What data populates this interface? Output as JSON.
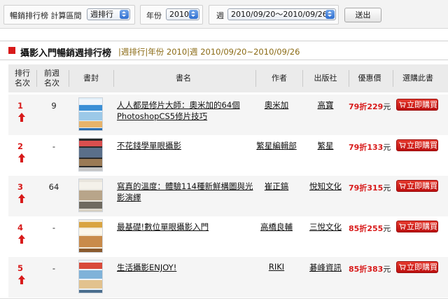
{
  "filters": {
    "ranking_label": "暢銷排行榜 計算區間",
    "ranking_value": "週排行",
    "year_label": "年份",
    "year_value": "2010",
    "week_label": "週",
    "week_value": "2010/09/20～2010/09/26",
    "submit_label": "送出"
  },
  "heading": {
    "title": "攝影入門暢銷週排行榜",
    "subtitle": "|週排行|年份 2010|週 2010/09/20~2010/09/26"
  },
  "columns": {
    "rank": "排行名次",
    "prev": "前週名次",
    "cover": "書封",
    "title": "書名",
    "author": "作者",
    "publisher": "出版社",
    "price": "優惠價",
    "buy": "選購此書"
  },
  "buy_label": "立即購買",
  "colors": {
    "accent_red": "#d81a1a",
    "header_gray": "#ebebeb",
    "subtitle_gold": "#8a6a14"
  },
  "rows": [
    {
      "rank": "1",
      "prev": "9",
      "title": "人人都是修片大師：奧米加的64個PhotoshopCS5修片技巧",
      "author": "奧米加",
      "publisher": "高寶",
      "discount": "79折",
      "price": "229",
      "currency": "元"
    },
    {
      "rank": "2",
      "prev": "-",
      "title": "不花錢學單眼攝影",
      "author": "繁星編輯部",
      "publisher": "繁星",
      "discount": "79折",
      "price": "133",
      "currency": "元"
    },
    {
      "rank": "3",
      "prev": "64",
      "title": "寫真的溫度：體驗114種新鮮構圖與光影演繹",
      "author": "崔正鎬",
      "publisher": "悅知文化",
      "discount": "79折",
      "price": "315",
      "currency": "元"
    },
    {
      "rank": "4",
      "prev": "-",
      "title": "最基礎!數位單眼攝影入門",
      "author": "高橋良輔",
      "publisher": "三悅文化",
      "discount": "85折",
      "price": "255",
      "currency": "元"
    },
    {
      "rank": "5",
      "prev": "-",
      "title": "生活攝影ENJOY!",
      "author": "RIKI",
      "publisher": "碁峰資訊",
      "discount": "85折",
      "price": "383",
      "currency": "元"
    }
  ]
}
